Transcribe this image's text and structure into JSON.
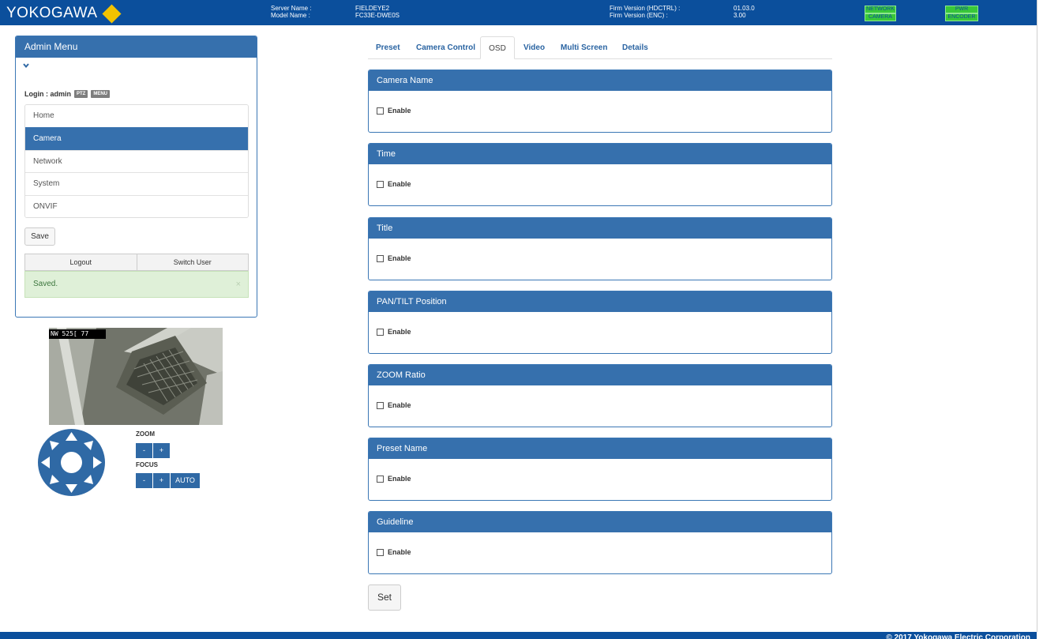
{
  "header": {
    "logo_text": "YOKOGAWA",
    "server_name_label": "Server Name :",
    "server_name": "FIELDEYE2",
    "model_name_label": "Model Name :",
    "model_name": "FC33E-DWE0S",
    "firm_hdctrl_label": "Firm Version (HDCTRL) :",
    "firm_hdctrl": "01.03.0",
    "firm_enc_label": "Firm Version (ENC) :",
    "firm_enc": "3.00",
    "status_badges": [
      "NETWORK",
      "CAMERA",
      "PWR",
      "ENCODER"
    ]
  },
  "admin": {
    "title": "Admin Menu",
    "login_label": "Login : admin",
    "ptz_badge": "PTZ",
    "menu_badge": "MENU",
    "nav_items": [
      "Home",
      "Camera",
      "Network",
      "System",
      "ONVIF"
    ],
    "active_item": "Camera",
    "save_label": "Save",
    "logout_label": "Logout",
    "switch_user_label": "Switch User",
    "alert_text": "Saved.",
    "alert_close": "×"
  },
  "camera_view": {
    "osd_text": "NW 525[ 77"
  },
  "ptz": {
    "zoom_label": "ZOOM",
    "focus_label": "FOCUS",
    "minus": "-",
    "plus": "+",
    "auto": "AUTO"
  },
  "tabs": [
    "Preset",
    "Camera Control",
    "OSD",
    "Video",
    "Multi Screen",
    "Details"
  ],
  "active_tab": "OSD",
  "sections": [
    {
      "title": "Camera Name",
      "option": "Enable",
      "checked": false
    },
    {
      "title": "Time",
      "option": "Enable",
      "checked": false
    },
    {
      "title": "Title",
      "option": "Enable",
      "checked": false
    },
    {
      "title": "PAN/TILT Position",
      "option": "Enable",
      "checked": false
    },
    {
      "title": "ZOOM Ratio",
      "option": "Enable",
      "checked": false
    },
    {
      "title": "Preset Name",
      "option": "Enable",
      "checked": false
    },
    {
      "title": "Guideline",
      "option": "Enable",
      "checked": false
    }
  ],
  "set_label": "Set",
  "footer_text": "© 2017 Yokogawa Electric Corporation",
  "colors": {
    "brand_blue": "#0b4f9c",
    "panel_blue": "#3670ad",
    "logo_yellow": "#f2c200",
    "badge_green": "#39c839",
    "alert_green": "#dff0d8"
  }
}
